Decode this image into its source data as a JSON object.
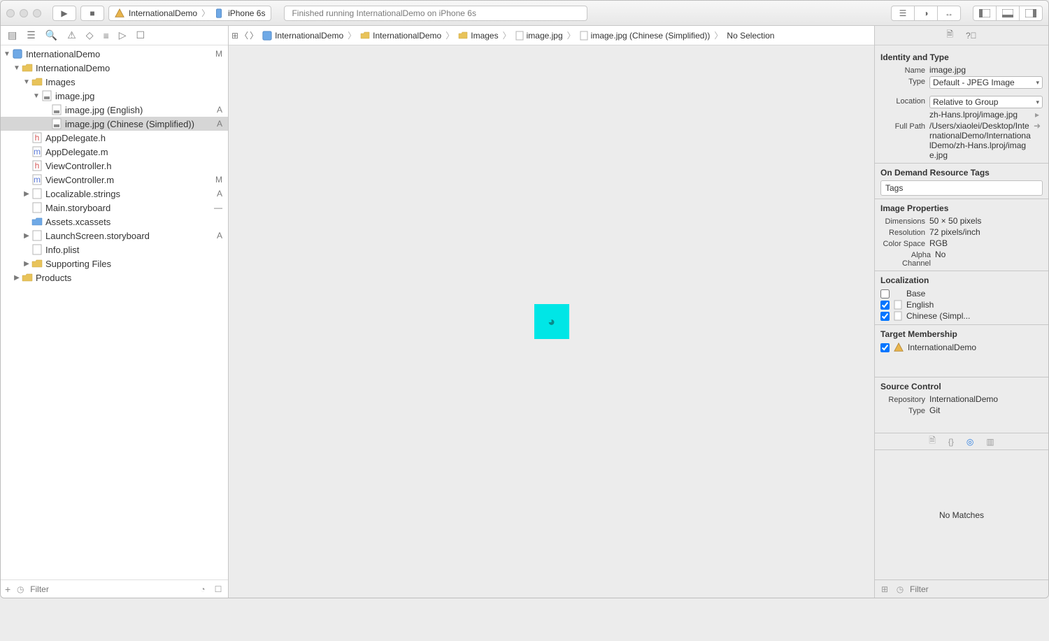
{
  "toolbar": {
    "scheme_project": "InternationalDemo",
    "scheme_device": "iPhone 6s",
    "status_text": "Finished running InternationalDemo on iPhone 6s"
  },
  "tree": {
    "root": {
      "label": "InternationalDemo",
      "vcs": "M"
    },
    "group": {
      "label": "InternationalDemo"
    },
    "images": {
      "label": "Images"
    },
    "imagejpg": {
      "label": "image.jpg"
    },
    "image_en": {
      "label": "image.jpg (English)",
      "vcs": "A"
    },
    "image_zh": {
      "label": "image.jpg (Chinese (Simplified))",
      "vcs": "A"
    },
    "appdel_h": {
      "label": "AppDelegate.h"
    },
    "appdel_m": {
      "label": "AppDelegate.m"
    },
    "vc_h": {
      "label": "ViewController.h"
    },
    "vc_m": {
      "label": "ViewController.m",
      "vcs": "M"
    },
    "locstrings": {
      "label": "Localizable.strings",
      "vcs": "A"
    },
    "mainsb": {
      "label": "Main.storyboard",
      "vcs": "—"
    },
    "assets": {
      "label": "Assets.xcassets"
    },
    "launchsb": {
      "label": "LaunchScreen.storyboard",
      "vcs": "A"
    },
    "info": {
      "label": "Info.plist"
    },
    "support": {
      "label": "Supporting Files"
    },
    "products": {
      "label": "Products"
    }
  },
  "nav_filter_placeholder": "Filter",
  "jumpbar": [
    "InternationalDemo",
    "InternationalDemo",
    "Images",
    "image.jpg",
    "image.jpg (Chinese (Simplified))",
    "No Selection"
  ],
  "inspector": {
    "identity": {
      "header": "Identity and Type",
      "name_k": "Name",
      "name_v": "image.jpg",
      "type_k": "Type",
      "type_v": "Default - JPEG Image",
      "loc_k": "Location",
      "loc_v": "Relative to Group",
      "loc_path": "zh-Hans.lproj/image.jpg",
      "full_k": "Full Path",
      "full_v": "/Users/xiaolei/Desktop/InternationalDemo/InternationalDemo/zh-Hans.lproj/image.jpg"
    },
    "odr": {
      "header": "On Demand Resource Tags",
      "placeholder": "Tags"
    },
    "imgprops": {
      "header": "Image Properties",
      "dim_k": "Dimensions",
      "dim_v": "50 × 50 pixels",
      "res_k": "Resolution",
      "res_v": "72 pixels/inch",
      "cs_k": "Color Space",
      "cs_v": "RGB",
      "alpha_k": "Alpha Channel",
      "alpha_v": "No"
    },
    "localization": {
      "header": "Localization",
      "base": "Base",
      "en": "English",
      "zh": "Chinese (Simpl..."
    },
    "target": {
      "header": "Target Membership",
      "name": "InternationalDemo"
    },
    "source": {
      "header": "Source Control",
      "repo_k": "Repository",
      "repo_v": "InternationalDemo",
      "type_k": "Type",
      "type_v": "Git"
    }
  },
  "library_empty": "No Matches",
  "library_filter_placeholder": "Filter"
}
